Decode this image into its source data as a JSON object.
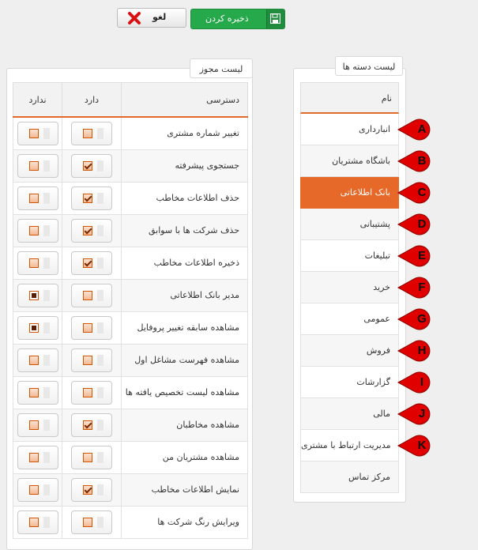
{
  "toolbar": {
    "cancel_label": "لغو",
    "save_label": "ذخیره کردن"
  },
  "categories": {
    "title": "لیست دسته ها",
    "header": "نام",
    "items": [
      {
        "label": "انبارداری",
        "marker": "A"
      },
      {
        "label": "باشگاه مشتریان",
        "marker": "B"
      },
      {
        "label": "بانک اطلاعاتی",
        "marker": "C",
        "selected": true
      },
      {
        "label": "پشتیبانی",
        "marker": "D"
      },
      {
        "label": "تبلیغات",
        "marker": "E"
      },
      {
        "label": "خرید",
        "marker": "F"
      },
      {
        "label": "عمومی",
        "marker": "G"
      },
      {
        "label": "فروش",
        "marker": "H"
      },
      {
        "label": "گزارشات",
        "marker": "I"
      },
      {
        "label": "مالی",
        "marker": "J"
      },
      {
        "label": "مدیریت ارتباط با مشتری",
        "marker": "K"
      },
      {
        "label": "مرکز تماس",
        "marker": ""
      }
    ]
  },
  "permissions": {
    "title": "لیست مجوز ها",
    "columns": {
      "access": "دسترسی",
      "has": "دارد",
      "hasnot": "ندارد"
    },
    "rows": [
      {
        "name": "تغییر شماره مشتری",
        "has": "empty",
        "hasnot": "empty"
      },
      {
        "name": "جستجوی پیشرفته",
        "has": "checked",
        "hasnot": "empty"
      },
      {
        "name": "حذف اطلاعات مخاطب",
        "has": "checked",
        "hasnot": "empty"
      },
      {
        "name": "حذف شرکت ها با سوابق",
        "has": "checked",
        "hasnot": "empty"
      },
      {
        "name": "ذخیره اطلاعات مخاطب",
        "has": "checked",
        "hasnot": "empty"
      },
      {
        "name": "مدیر بانک اطلاعاتی",
        "has": "empty",
        "hasnot": "filled"
      },
      {
        "name": "مشاهده سابقه تغییر پروفایل",
        "has": "empty",
        "hasnot": "filled"
      },
      {
        "name": "مشاهده فهرست مشاغل اول",
        "has": "empty",
        "hasnot": "empty"
      },
      {
        "name": "مشاهده لیست تخصیص یافته ها",
        "has": "empty",
        "hasnot": "empty"
      },
      {
        "name": "مشاهده مخاطبان",
        "has": "checked",
        "hasnot": "empty"
      },
      {
        "name": "مشاهده مشتریان من",
        "has": "empty",
        "hasnot": "empty"
      },
      {
        "name": "نمایش اطلاعات مخاطب",
        "has": "checked",
        "hasnot": "empty"
      },
      {
        "name": "ویرایش رنگ شرکت ها",
        "has": "empty",
        "hasnot": "empty"
      }
    ]
  },
  "colors": {
    "accent": "#e7692a",
    "save": "#26a94b",
    "marker": "#e00000"
  }
}
